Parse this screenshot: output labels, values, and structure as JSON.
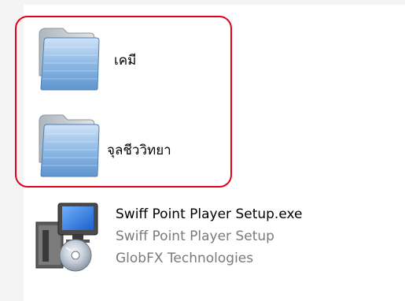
{
  "folders": [
    {
      "name": "เคมี",
      "icon": "folder-icon"
    },
    {
      "name": "จุลชีววิทยา",
      "icon": "folder-icon"
    }
  ],
  "file": {
    "name": "Swiff Point Player Setup.exe",
    "description": "Swiff Point Player Setup",
    "company": "GlobFX Technologies",
    "icon": "installer-icon"
  },
  "colors": {
    "highlight": "#e2001a",
    "secondary_text": "#7a7a7a"
  }
}
